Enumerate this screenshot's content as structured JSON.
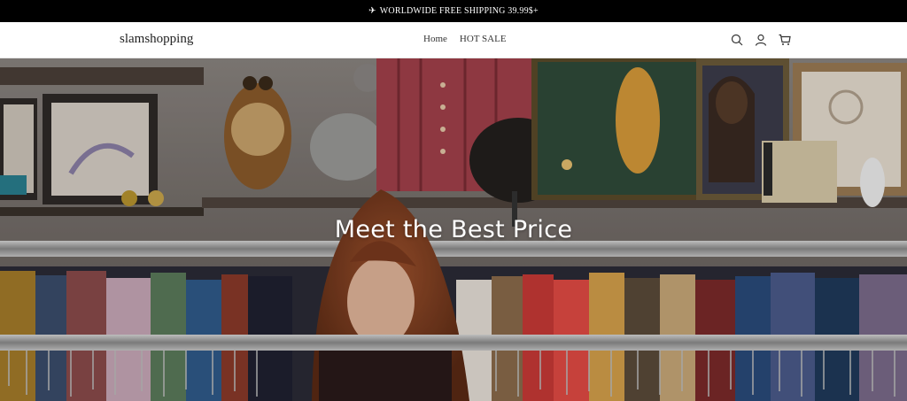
{
  "announcement": {
    "icon": "airplane-icon",
    "text": "WORLDWIDE FREE SHIPPING 39.99$+"
  },
  "header": {
    "logo": "slamshopping",
    "nav": [
      {
        "label": "Home"
      },
      {
        "label": "HOT SALE"
      }
    ],
    "icons": [
      "search-icon",
      "account-icon",
      "cart-icon"
    ]
  },
  "hero": {
    "title": "Meet the Best Price",
    "image": "woman-browsing-clothing-rack-in-thrift-store"
  },
  "colors": {
    "announcement_bg": "#000000",
    "header_bg": "#ffffff",
    "text": "#222222"
  }
}
